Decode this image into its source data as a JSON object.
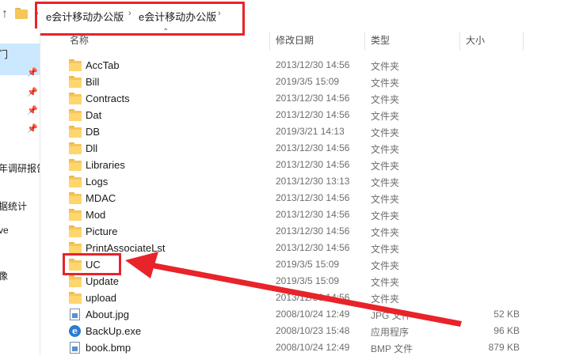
{
  "address": {
    "crumbs": [
      "e会计移动办公版",
      "e会计移动办公版"
    ],
    "separator": "›",
    "up_icon": "up-arrow-icon"
  },
  "sidebar": {
    "items": [
      {
        "label": "门"
      },
      {
        "label": "年调研报告"
      },
      {
        "label": "据统计"
      },
      {
        "label": "ve"
      },
      {
        "label": "像"
      }
    ]
  },
  "columns": {
    "name": "名称",
    "date": "修改日期",
    "type": "类型",
    "size": "大小"
  },
  "files": [
    {
      "name": "AccTab",
      "date": "2013/12/30 14:56",
      "type": "文件夹",
      "size": "",
      "icon": "folder"
    },
    {
      "name": "Bill",
      "date": "2019/3/5 15:09",
      "type": "文件夹",
      "size": "",
      "icon": "folder"
    },
    {
      "name": "Contracts",
      "date": "2013/12/30 14:56",
      "type": "文件夹",
      "size": "",
      "icon": "folder"
    },
    {
      "name": "Dat",
      "date": "2013/12/30 14:56",
      "type": "文件夹",
      "size": "",
      "icon": "folder"
    },
    {
      "name": "DB",
      "date": "2019/3/21 14:13",
      "type": "文件夹",
      "size": "",
      "icon": "folder"
    },
    {
      "name": "Dll",
      "date": "2013/12/30 14:56",
      "type": "文件夹",
      "size": "",
      "icon": "folder"
    },
    {
      "name": "Libraries",
      "date": "2013/12/30 14:56",
      "type": "文件夹",
      "size": "",
      "icon": "folder"
    },
    {
      "name": "Logs",
      "date": "2013/12/30 13:13",
      "type": "文件夹",
      "size": "",
      "icon": "folder"
    },
    {
      "name": "MDAC",
      "date": "2013/12/30 14:56",
      "type": "文件夹",
      "size": "",
      "icon": "folder"
    },
    {
      "name": "Mod",
      "date": "2013/12/30 14:56",
      "type": "文件夹",
      "size": "",
      "icon": "folder"
    },
    {
      "name": "Picture",
      "date": "2013/12/30 14:56",
      "type": "文件夹",
      "size": "",
      "icon": "folder"
    },
    {
      "name": "PrintAssociateLst",
      "date": "2013/12/30 14:56",
      "type": "文件夹",
      "size": "",
      "icon": "folder"
    },
    {
      "name": "UC",
      "date": "2019/3/5 15:09",
      "type": "文件夹",
      "size": "",
      "icon": "folder"
    },
    {
      "name": "Update",
      "date": "2019/3/5 15:09",
      "type": "文件夹",
      "size": "",
      "icon": "folder"
    },
    {
      "name": "upload",
      "date": "2013/12/30 14:56",
      "type": "文件夹",
      "size": "",
      "icon": "folder"
    },
    {
      "name": "About.jpg",
      "date": "2008/10/24 12:49",
      "type": "JPG 文件",
      "size": "52 KB",
      "icon": "image-file"
    },
    {
      "name": "BackUp.exe",
      "date": "2008/10/23 15:48",
      "type": "应用程序",
      "size": "96 KB",
      "icon": "exe"
    },
    {
      "name": "book.bmp",
      "date": "2008/10/24 12:49",
      "type": "BMP 文件",
      "size": "879 KB",
      "icon": "image-file"
    }
  ],
  "annotation": {
    "highlight_color": "#e8232a",
    "exe_glyph": "e"
  }
}
